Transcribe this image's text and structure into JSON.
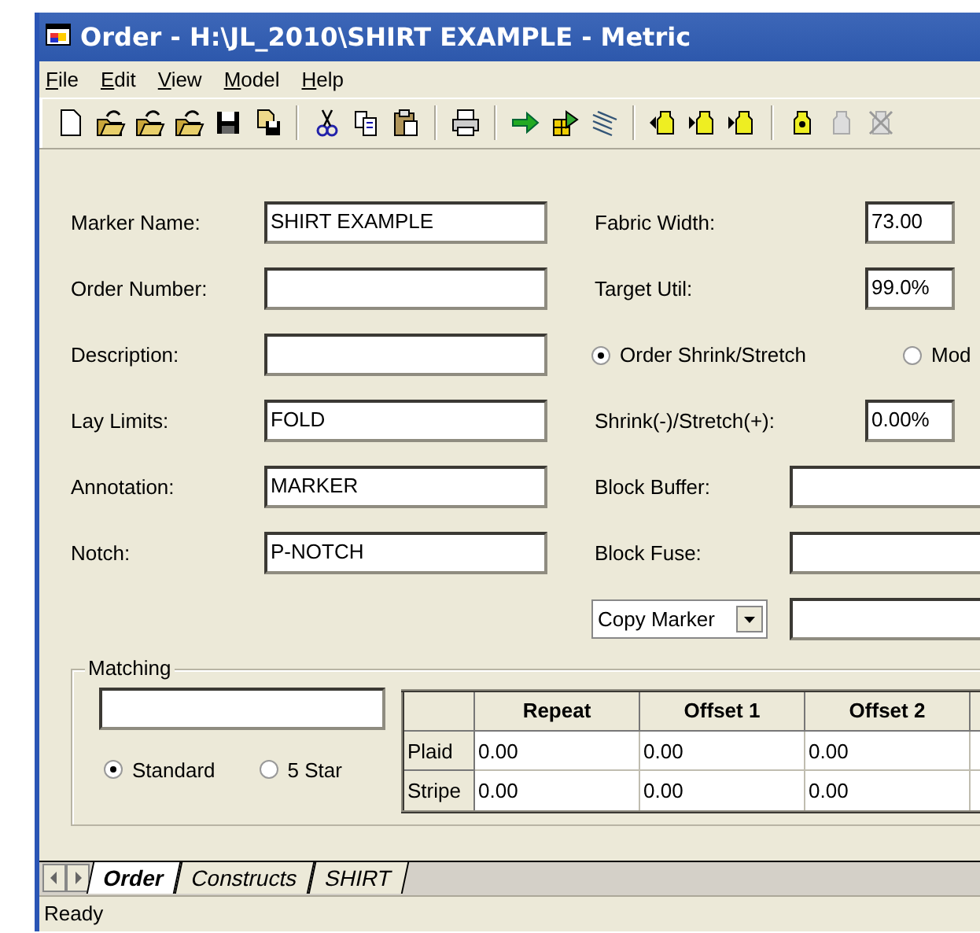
{
  "window": {
    "title": "Order - H:\\JL_2010\\SHIRT EXAMPLE - Metric"
  },
  "menu": [
    "File",
    "Edit",
    "View",
    "Model",
    "Help"
  ],
  "form": {
    "left_fields": [
      {
        "label": "Marker Name:",
        "value": "SHIRT EXAMPLE"
      },
      {
        "label": "Order Number:"
      },
      {
        "label": "Description:"
      },
      {
        "label": "Lay Limits:",
        "value": "FOLD"
      },
      {
        "label": "Annotation:",
        "value": "MARKER"
      },
      {
        "label": "Notch:",
        "value": "P-NOTCH"
      }
    ],
    "right_rows": [
      {
        "kind": "field",
        "label": "Fabric Width:",
        "value": "73.00"
      },
      {
        "kind": "field",
        "label": "Target Util:",
        "value": "99.0%"
      },
      {
        "kind": "radios",
        "options": [
          {
            "label": "Order Shrink/Stretch",
            "selected": true
          },
          {
            "label": "Mod",
            "selected": false
          }
        ]
      },
      {
        "kind": "field",
        "label": "Shrink(-)/Stretch(+):",
        "value": "0.00%"
      },
      {
        "kind": "wide",
        "label": "Block Buffer:"
      },
      {
        "kind": "wide",
        "label": "Block Fuse:"
      },
      {
        "kind": "dropdown",
        "value": "Copy Marker"
      }
    ]
  },
  "matching": {
    "title": "Matching",
    "options": [
      {
        "label": "Standard",
        "selected": true
      },
      {
        "label": "5 Star",
        "selected": false
      }
    ],
    "table": {
      "columns": [
        "Repeat",
        "Offset 1",
        "Offset 2"
      ],
      "rows": [
        {
          "header": "Plaid",
          "cells": [
            "0.00",
            "0.00",
            "0.00"
          ]
        },
        {
          "header": "Stripe",
          "cells": [
            "0.00",
            "0.00",
            "0.00"
          ]
        }
      ]
    }
  },
  "sheet_tabs": [
    {
      "label": "Order",
      "selected": true
    },
    {
      "label": "Constructs",
      "selected": false
    },
    {
      "label": "SHIRT",
      "selected": false
    }
  ],
  "status_bar": "Ready"
}
